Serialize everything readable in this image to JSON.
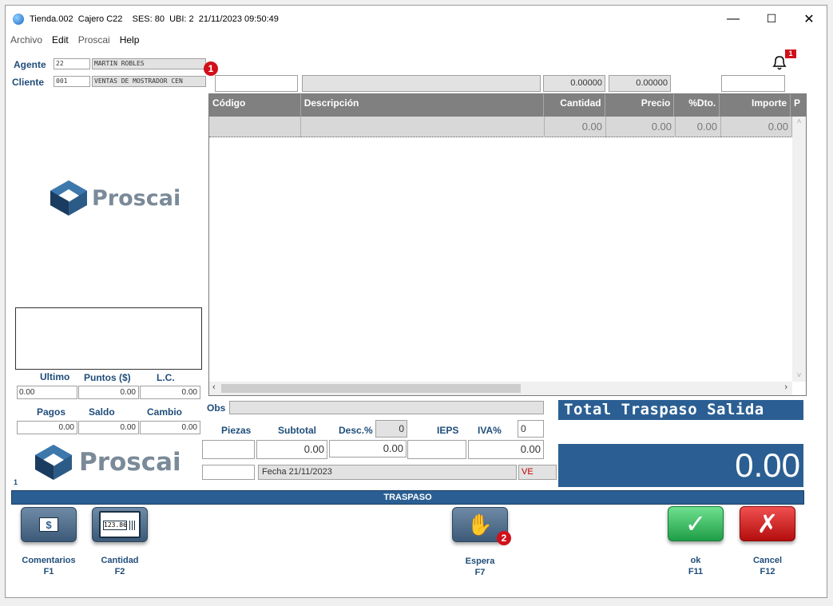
{
  "window": {
    "title": "Tienda.002  Cajero C22    SES: 80  UBI: 2  21/11/2023 09:50:49",
    "minimize": "—",
    "maximize": "☐",
    "close": "✕"
  },
  "menu": [
    "Archivo",
    "Edit",
    "Proscai",
    "Help"
  ],
  "agente": {
    "label": "Agente",
    "code": "22",
    "name": "MARTIN ROBLES"
  },
  "cliente": {
    "label": "Cliente",
    "code": "001",
    "name": "VENTAS DE MOSTRADOR CEN"
  },
  "badges": {
    "one": "1",
    "two": "2",
    "notif_count": "1"
  },
  "top_fields": {
    "qty_a": "0.00000",
    "qty_b": "0.00000"
  },
  "grid": {
    "columns": [
      "Código",
      "Descripción",
      "Cantidad",
      "Precio",
      "%Dto.",
      "Importe",
      "P"
    ],
    "row": [
      "",
      "",
      "0.00",
      "0.00",
      "0.00",
      "0.00"
    ]
  },
  "brand": "Proscai",
  "summary1": {
    "labels": [
      "Ultimo",
      "Puntos ($)",
      "L.C."
    ],
    "values": [
      "0.00",
      "0.00",
      "0.00"
    ]
  },
  "summary2": {
    "labels": [
      "Pagos",
      "Saldo",
      "Cambio"
    ],
    "values": [
      "0.00",
      "0.00",
      "0.00"
    ]
  },
  "obs_label": "Obs",
  "totals": {
    "labels": [
      "Piezas",
      "Subtotal",
      "Desc.%",
      "IEPS",
      "IVA%"
    ],
    "desc_pct": "0",
    "iva_pct": "0",
    "subtotal": "0.00",
    "desc_amount": "0.00",
    "iva_amount": "0.00"
  },
  "fecha": "Fecha 21/11/2023",
  "ve": "VE",
  "left_number": "1",
  "total_title": "Total Traspaso Salida",
  "total_value": "0.00",
  "mode_bar": "TRASPASO",
  "buttons": {
    "comentarios": [
      "Comentarios",
      "F1"
    ],
    "cantidad": [
      "Cantidad",
      "F2"
    ],
    "espera": [
      "Espera",
      "F7"
    ],
    "ok": [
      "ok",
      "F11"
    ],
    "cancel": [
      "Cancel",
      "F12"
    ],
    "calc_display": "123.86"
  },
  "colors": {
    "accent": "#2b5f93",
    "label_blue": "#1f4d7a",
    "badge_red": "#d0101a"
  }
}
